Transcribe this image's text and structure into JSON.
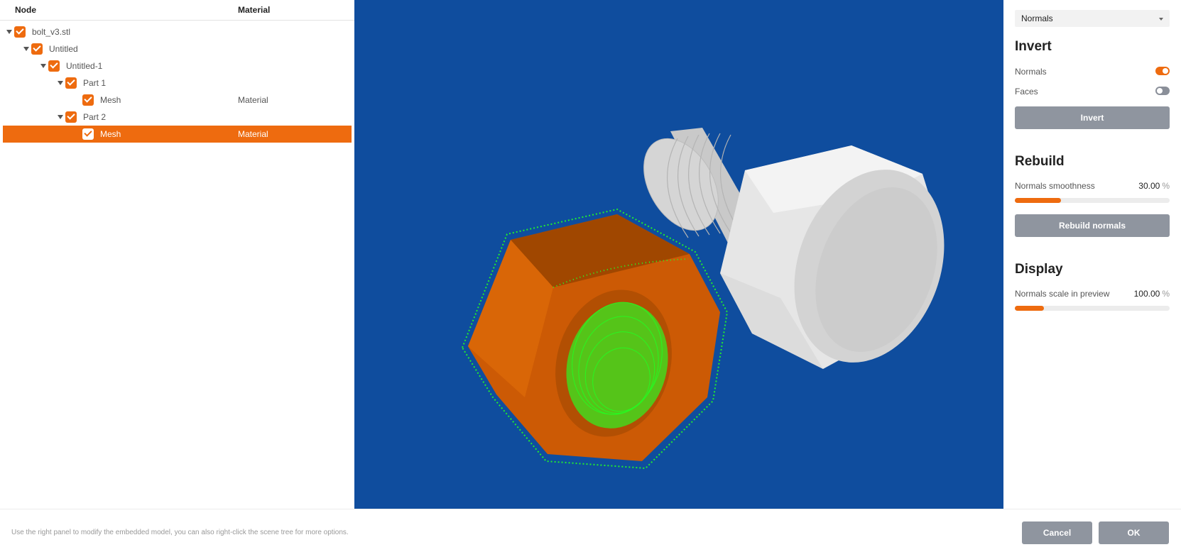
{
  "tree": {
    "columns": {
      "node": "Node",
      "material": "Material"
    },
    "rows": [
      {
        "label": "bolt_v3.stl",
        "material": ""
      },
      {
        "label": "Untitled",
        "material": ""
      },
      {
        "label": "Untitled-1",
        "material": ""
      },
      {
        "label": "Part 1",
        "material": ""
      },
      {
        "label": "Mesh",
        "material": "Material"
      },
      {
        "label": "Part 2",
        "material": ""
      },
      {
        "label": "Mesh",
        "material": "Material"
      }
    ]
  },
  "panel": {
    "mode_select": "Normals",
    "invert": {
      "title": "Invert",
      "normals_label": "Normals",
      "faces_label": "Faces",
      "normals_on": true,
      "faces_on": false,
      "button": "Invert"
    },
    "rebuild": {
      "title": "Rebuild",
      "smoothness_label": "Normals smoothness",
      "smoothness_value": "30.00",
      "smoothness_unit": "%",
      "smoothness_percent": 30,
      "button": "Rebuild normals"
    },
    "display": {
      "title": "Display",
      "scale_label": "Normals scale in preview",
      "scale_value": "100.00",
      "scale_unit": "%",
      "scale_fill_percent": 19,
      "button": ""
    }
  },
  "footer": {
    "hint": "Use the right panel to modify the embedded model, you can also right-click the scene tree for more options.",
    "cancel": "Cancel",
    "ok": "OK"
  },
  "colors": {
    "accent": "#ee6b0f",
    "viewport_bg": "#0f4d9e",
    "normals": "#22ff22",
    "button": "#8f959f"
  }
}
